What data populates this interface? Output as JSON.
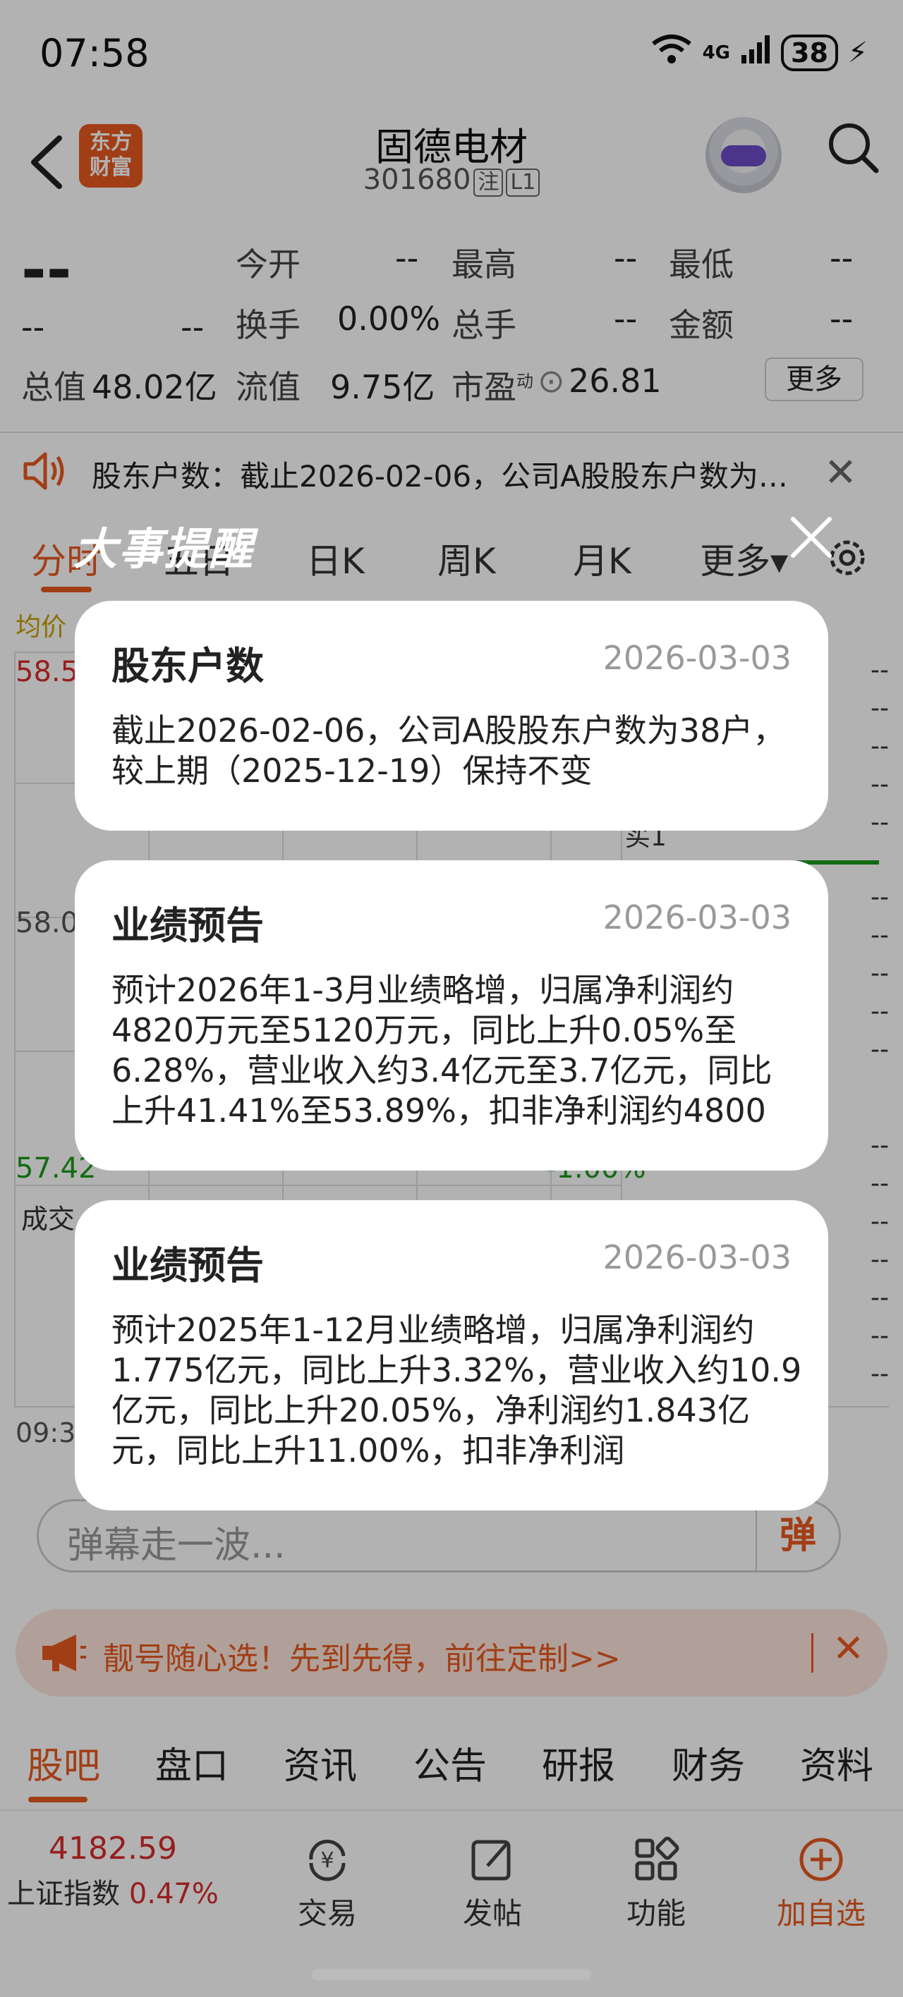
{
  "status": {
    "time": "07:58",
    "network": "4G",
    "battery": "38"
  },
  "header": {
    "logo_line1": "东方",
    "logo_line2": "财富",
    "name": "固德电材",
    "code": "301680",
    "tag1": "注",
    "tag2": "L1"
  },
  "quote": {
    "price": "--",
    "change": "--",
    "change_pct": "--",
    "open_label": "今开",
    "open": "--",
    "high_label": "最高",
    "high": "--",
    "low_label": "最低",
    "low": "--",
    "turnover_label": "换手",
    "turnover": "0.00%",
    "volume_label": "总手",
    "volume": "--",
    "amount_label": "金额",
    "amount": "--",
    "mktcap_label": "总值",
    "mktcap": "48.02亿",
    "float_label": "流值",
    "float": "9.75亿",
    "pe_label": "市盈",
    "pe_sup": "动",
    "pe": "26.81",
    "more": "更多"
  },
  "notice": {
    "text": "股东户数：截止2026-02-06，公司A股股东户数为3..."
  },
  "chart_tabs": [
    "分时",
    "五日",
    "日K",
    "周K",
    "月K",
    "更多▾"
  ],
  "chart": {
    "avg_label": "均价",
    "y_top": "58.5",
    "y_mid": "58.0",
    "y_low": "57.42",
    "pct_low": "-1.00%",
    "vol_label": "成交",
    "time_start": "09:3",
    "buy1": "买1"
  },
  "modal": {
    "title": "大事提醒",
    "cards": [
      {
        "title": "股东户数",
        "date": "2026-03-03",
        "body": "截止2026-02-06，公司A股股东户数为38户，较上期（2025-12-19）保持不变"
      },
      {
        "title": "业绩预告",
        "date": "2026-03-03",
        "body": "预计2026年1-3月业绩略增，归属净利润约4820万元至5120万元，同比上升0.05%至6.28%，营业收入约3.4亿元至3.7亿元，同比上升41.41%至53.89%，扣非净利润约4800"
      },
      {
        "title": "业绩预告",
        "date": "2026-03-03",
        "body": "预计2025年1-12月业绩略增，归属净利润约1.775亿元，同比上升3.32%，营业收入约10.9亿元，同比上升20.05%，净利润约1.843亿元，同比上升11.00%，扣非净利润"
      }
    ]
  },
  "danmu": {
    "placeholder": "弹幕走一波...",
    "button": "弹"
  },
  "promo": {
    "text": "靓号随心选！先到先得，前往定制>>"
  },
  "bottom_tabs": [
    "股吧",
    "盘口",
    "资讯",
    "公告",
    "研报",
    "财务",
    "资料"
  ],
  "bottom_nav": {
    "index_value": "4182.59",
    "index_name": "上证指数",
    "index_pct": "0.47%",
    "trade": "交易",
    "post": "发帖",
    "func": "功能",
    "add": "加自选"
  },
  "colors": {
    "accent": "#e85a20",
    "up": "#d92b2b",
    "down": "#1a9a1a"
  }
}
